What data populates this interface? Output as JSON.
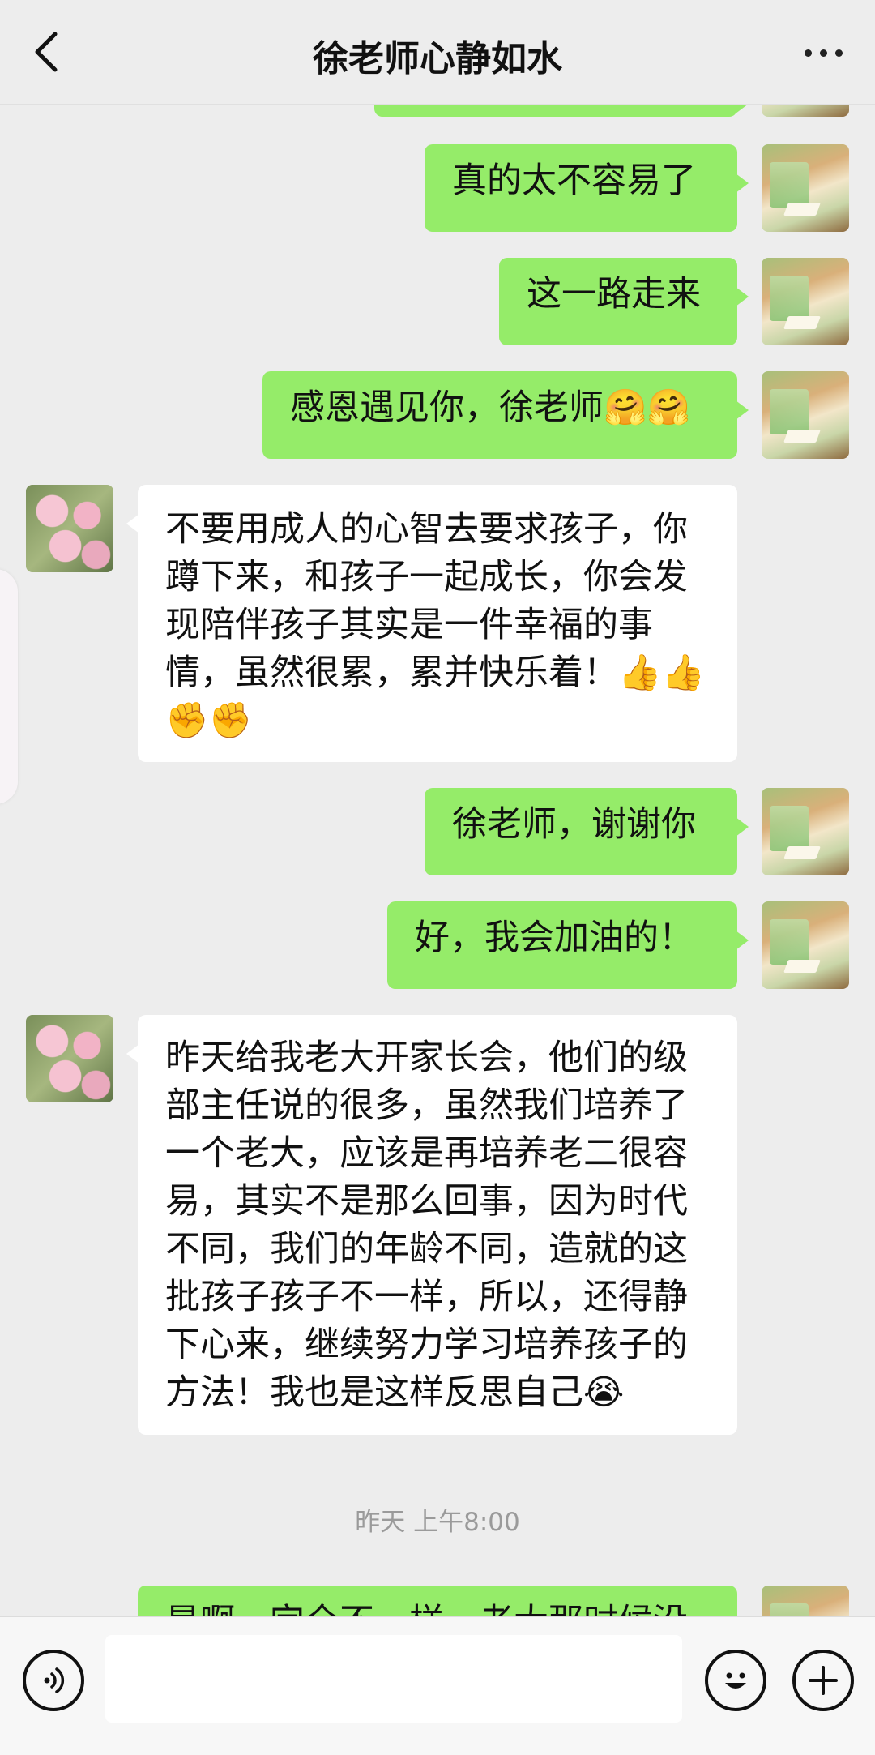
{
  "header": {
    "title": "徐老师心静如水"
  },
  "messages": [
    {
      "from": "me",
      "text": "真的太不容易了"
    },
    {
      "from": "me",
      "text": "这一路走来"
    },
    {
      "from": "me",
      "text": "感恩遇见你，徐老师🤗🤗"
    },
    {
      "from": "them",
      "text": "不要用成人的心智去要求孩子，你蹲下来，和孩子一起成长，你会发现陪伴孩子其实是一件幸福的事情，虽然很累，累并快乐着！👍👍✊✊"
    },
    {
      "from": "me",
      "text": "徐老师，谢谢你"
    },
    {
      "from": "me",
      "text": "好，我会加油的！"
    },
    {
      "from": "them",
      "text": "昨天给我老大开家长会，他们的级部主任说的很多，虽然我们培养了一个老大，应该是再培养老二很容易，其实不是那么回事，因为时代不同，我们的年龄不同，造就的这批孩子孩子不一样，所以，还得静下心来，继续努力学习培养孩子的方法！我也是这样反思自己😭"
    },
    {
      "from": "me",
      "text": "是啊，完全不一样，老大那时候没"
    }
  ],
  "timestamp": "昨天 上午8:00",
  "icons": {
    "back": "chevron-left-icon",
    "more": "more-dots-icon",
    "voice": "voice-icon",
    "emoji": "smiley-icon",
    "plus": "plus-icon"
  },
  "colors": {
    "background": "#ededed",
    "my_bubble": "#95ec69",
    "their_bubble": "#ffffff"
  }
}
